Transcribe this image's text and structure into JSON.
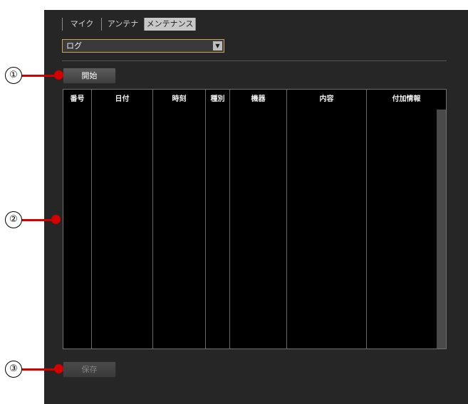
{
  "tabs": [
    {
      "label": "マイク",
      "active": false
    },
    {
      "label": "アンテナ",
      "active": false
    },
    {
      "label": "メンテナンス",
      "active": true
    }
  ],
  "dropdown": {
    "value": "ログ",
    "arrow_icon": "triangle-down-icon"
  },
  "buttons": {
    "start": "開始",
    "save": "保存"
  },
  "table": {
    "columns": [
      "番号",
      "日付",
      "時刻",
      "種別",
      "機器",
      "内容",
      "付加情報"
    ],
    "rows": []
  },
  "callouts": [
    "①",
    "②",
    "③"
  ],
  "colors": {
    "accent": "#d40000",
    "panel": "#262626",
    "table_bg": "#000000",
    "dropdown_border": "#c9a45a"
  }
}
